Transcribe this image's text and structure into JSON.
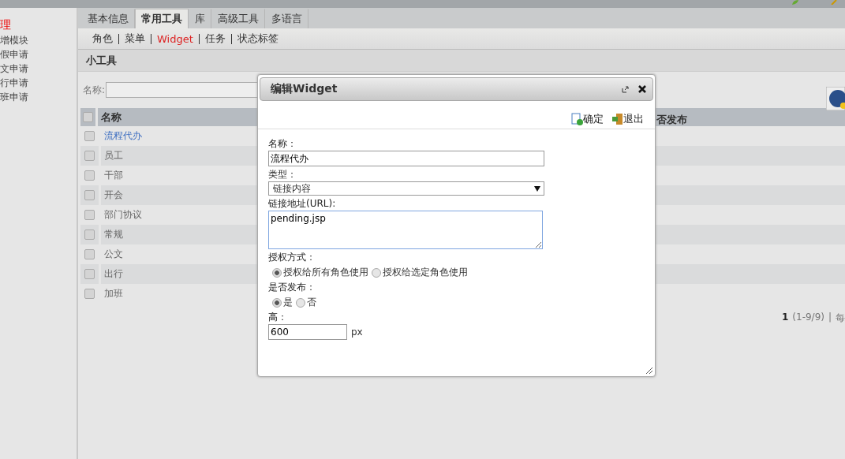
{
  "sidebar": {
    "items": [
      {
        "label": "理",
        "selected": true
      },
      {
        "label": "增模块",
        "selected": false
      },
      {
        "label": "假申请",
        "selected": false
      },
      {
        "label": "文申请",
        "selected": false
      },
      {
        "label": "行申请",
        "selected": false
      },
      {
        "label": "班申请",
        "selected": false
      }
    ]
  },
  "tabs": [
    {
      "label": "基本信息",
      "selected": false
    },
    {
      "label": "常用工具",
      "selected": true
    },
    {
      "label": "库",
      "selected": false
    },
    {
      "label": "高级工具",
      "selected": false
    },
    {
      "label": "多语言",
      "selected": false
    }
  ],
  "subnav": [
    {
      "label": "角色",
      "selected": false
    },
    {
      "label": "菜单",
      "selected": false
    },
    {
      "label": "Widget",
      "selected": true
    },
    {
      "label": "任务",
      "selected": false
    },
    {
      "label": "状态标签",
      "selected": false
    }
  ],
  "section_title": "小工具",
  "search": {
    "label": "名称:"
  },
  "table": {
    "select_all_checked": false,
    "columns": [
      "名称",
      "否发布"
    ],
    "rows": [
      {
        "name": "流程代办",
        "kind": "link",
        "checked": false
      },
      {
        "name": "员工",
        "kind": "text",
        "checked": false
      },
      {
        "name": "干部",
        "kind": "text",
        "checked": false
      },
      {
        "name": "开会",
        "kind": "text",
        "checked": false
      },
      {
        "name": "部门协议",
        "kind": "text",
        "checked": false
      },
      {
        "name": "常规",
        "kind": "text",
        "checked": false
      },
      {
        "name": "公文",
        "kind": "text",
        "checked": false
      },
      {
        "name": "出行",
        "kind": "text",
        "checked": false
      },
      {
        "name": "加班",
        "kind": "text",
        "checked": false
      }
    ]
  },
  "pagination": {
    "page": "1",
    "range": "(1-9/9)",
    "separator": "|",
    "per_page": "每"
  },
  "dialog": {
    "title": "编辑Widget",
    "actions": [
      {
        "label": "确定",
        "kind": "confirm"
      },
      {
        "label": "退出",
        "kind": "exit"
      }
    ],
    "fields": [
      {
        "kind": "text",
        "label": "名称：",
        "value": "流程代办"
      },
      {
        "kind": "select",
        "label": "类型：",
        "value": "链接内容"
      },
      {
        "kind": "textarea",
        "label": "链接地址(URL):",
        "value": "pending.jsp"
      },
      {
        "kind": "radio",
        "label": "授权方式：",
        "options": [
          {
            "label": "授权给所有角色使用",
            "selected": true
          },
          {
            "label": "授权给选定角色使用",
            "selected": false
          }
        ]
      },
      {
        "kind": "radio",
        "label": "是否发布：",
        "options": [
          {
            "label": "是",
            "selected": true
          },
          {
            "label": "否",
            "selected": false
          }
        ]
      },
      {
        "kind": "short",
        "label": "高：",
        "value": "600",
        "unit": "px"
      }
    ]
  }
}
